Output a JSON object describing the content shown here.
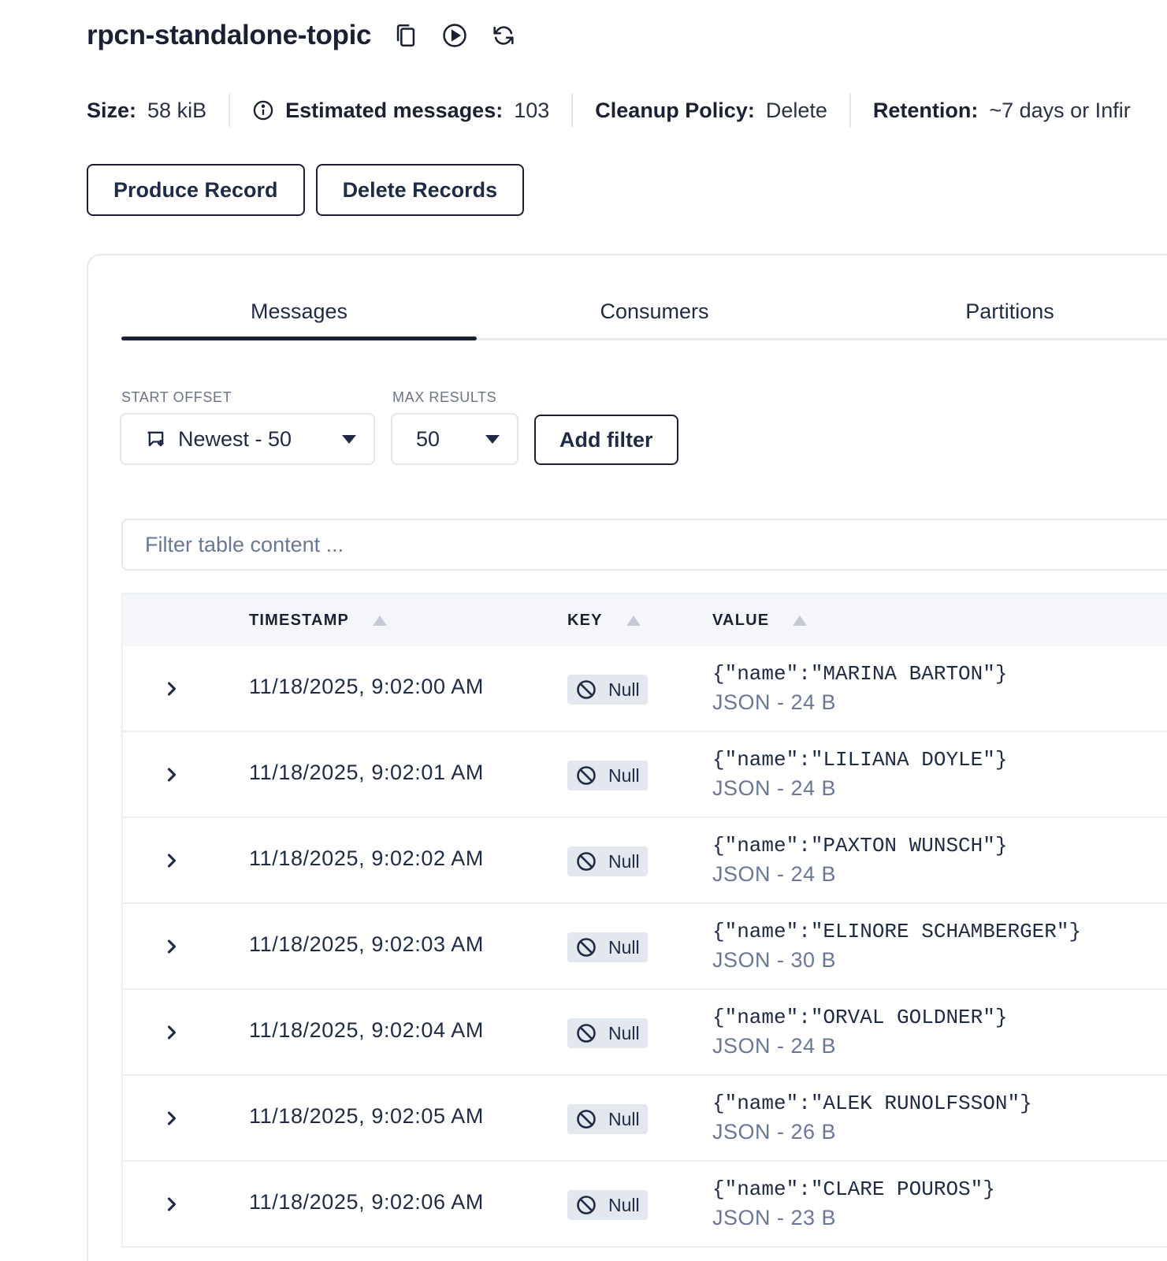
{
  "header": {
    "title": "rpcn-standalone-topic",
    "icons": [
      "copy-icon",
      "play-circle-icon",
      "refresh-icon"
    ]
  },
  "stats": {
    "size_label": "Size:",
    "size_value": "58 kiB",
    "messages_label": "Estimated messages:",
    "messages_value": "103",
    "cleanup_label": "Cleanup Policy:",
    "cleanup_value": "Delete",
    "retention_label": "Retention:",
    "retention_value": "~7 days or Infir"
  },
  "actions": {
    "produce_label": "Produce Record",
    "delete_label": "Delete Records"
  },
  "tabs": [
    {
      "label": "Messages",
      "active": true
    },
    {
      "label": "Consumers",
      "active": false
    },
    {
      "label": "Partitions",
      "active": false
    }
  ],
  "filters": {
    "start_offset_label": "START OFFSET",
    "start_offset_value": "Newest - 50",
    "max_results_label": "MAX RESULTS",
    "max_results_value": "50",
    "add_filter_label": "Add filter",
    "search_placeholder": "Filter table content ..."
  },
  "table": {
    "columns": [
      "TIMESTAMP",
      "KEY",
      "VALUE"
    ],
    "rows": [
      {
        "timestamp": "11/18/2025, 9:02:00 AM",
        "key": "Null",
        "value": "{\"name\":\"MARINA BARTON\"}",
        "meta": "JSON - 24 B"
      },
      {
        "timestamp": "11/18/2025, 9:02:01 AM",
        "key": "Null",
        "value": "{\"name\":\"LILIANA DOYLE\"}",
        "meta": "JSON - 24 B"
      },
      {
        "timestamp": "11/18/2025, 9:02:02 AM",
        "key": "Null",
        "value": "{\"name\":\"PAXTON WUNSCH\"}",
        "meta": "JSON - 24 B"
      },
      {
        "timestamp": "11/18/2025, 9:02:03 AM",
        "key": "Null",
        "value": "{\"name\":\"ELINORE SCHAMBERGER\"}",
        "meta": "JSON - 30 B"
      },
      {
        "timestamp": "11/18/2025, 9:02:04 AM",
        "key": "Null",
        "value": "{\"name\":\"ORVAL GOLDNER\"}",
        "meta": "JSON - 24 B"
      },
      {
        "timestamp": "11/18/2025, 9:02:05 AM",
        "key": "Null",
        "value": "{\"name\":\"ALEK RUNOLFSSON\"}",
        "meta": "JSON - 26 B"
      },
      {
        "timestamp": "11/18/2025, 9:02:06 AM",
        "key": "Null",
        "value": "{\"name\":\"CLARE POUROS\"}",
        "meta": "JSON - 23 B"
      }
    ]
  }
}
